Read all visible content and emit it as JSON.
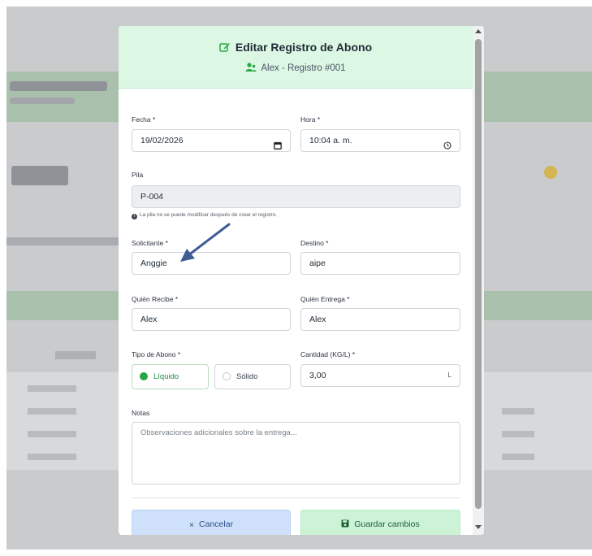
{
  "modal": {
    "title": "Editar Registro de Abono",
    "subtitle": "Alex - Registro #001"
  },
  "form": {
    "fecha": {
      "label": "Fecha *",
      "value": "19/02/2026"
    },
    "hora": {
      "label": "Hora *",
      "value": "10:04 a. m."
    },
    "pila": {
      "label": "Pila",
      "value": "P-004",
      "hint": "La pila no se puede modificar después de crear el registro."
    },
    "solicitante": {
      "label": "Solicitante *",
      "value": "Anggie"
    },
    "destino": {
      "label": "Destino *",
      "value": "aipe"
    },
    "quien_recibe": {
      "label": "Quién Recibe *",
      "value": "Alex"
    },
    "quien_entrega": {
      "label": "Quién Entrega *",
      "value": "Alex"
    },
    "tipo_abono": {
      "label": "Tipo de Abono *",
      "options": [
        {
          "label": "Líquido",
          "selected": true
        },
        {
          "label": "Sólido",
          "selected": false
        }
      ]
    },
    "cantidad": {
      "label": "Cantidad (KG/L) *",
      "value": "3,00",
      "unit": "L"
    },
    "notas": {
      "label": "Notas",
      "placeholder": "Observaciones adicionales sobre la entrega..."
    }
  },
  "buttons": {
    "cancel_icon": "×",
    "cancel": "Cancelar",
    "save": "Guardar cambios"
  },
  "icons": {
    "edit": "edit-icon",
    "user": "users-icon",
    "calendar": "calendar-icon",
    "clock": "clock-icon",
    "info": "info-icon",
    "save": "floppy-disk-icon"
  },
  "colors": {
    "header_bg": "#dcf7e4",
    "accent_green": "#29a745",
    "cancel_bg": "#cfe0fb",
    "save_bg": "#cdf3d7",
    "annotation_arrow": "#3f5c94"
  }
}
